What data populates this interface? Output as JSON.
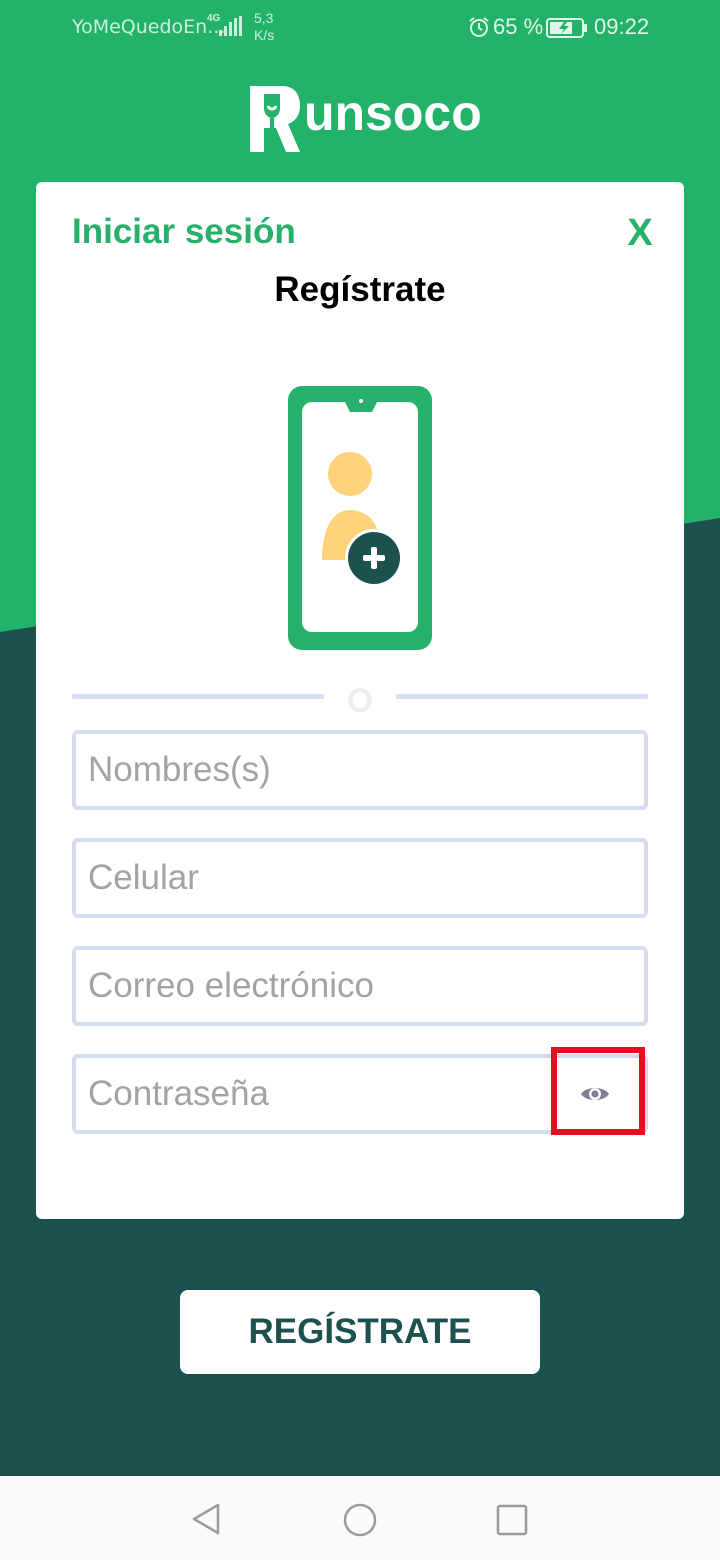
{
  "status_bar": {
    "carrier": "YoMeQuedoEn...",
    "network": "4G",
    "speed_value": "5,3",
    "speed_unit": "K/s",
    "battery_percent": "65 %",
    "time": "09:22"
  },
  "logo": {
    "text": "unsoco"
  },
  "card": {
    "login_link": "Iniciar sesión",
    "close_label": "X",
    "title": "Regístrate",
    "divider_text": "O"
  },
  "form": {
    "name_placeholder": "Nombres(s)",
    "phone_placeholder": "Celular",
    "email_placeholder": "Correo electrónico",
    "password_placeholder": "Contraseña"
  },
  "register_button": "REGÍSTRATE",
  "colors": {
    "brand_green": "#27b06b",
    "dark_teal": "#1c5150",
    "highlight_red": "#e3101e"
  }
}
